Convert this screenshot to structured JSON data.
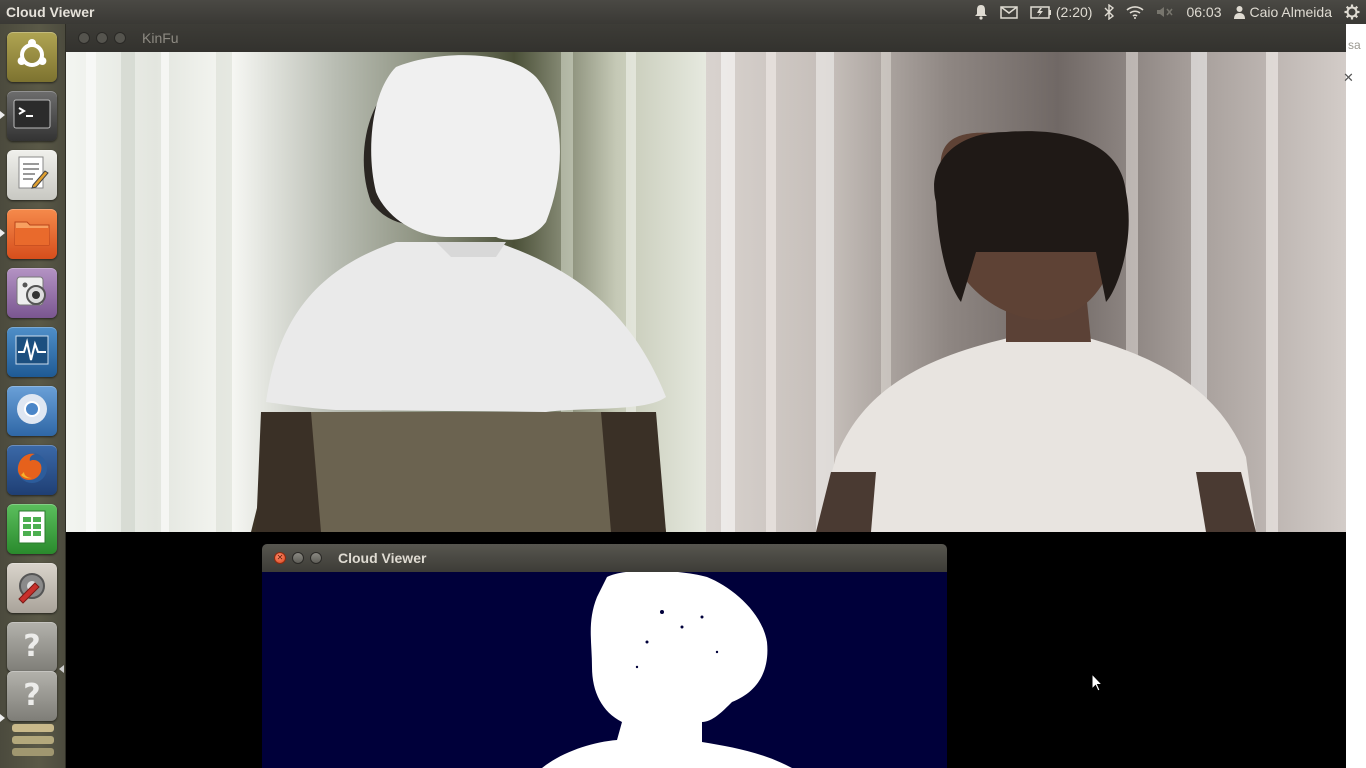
{
  "top_panel": {
    "app_title": "Cloud Viewer",
    "battery_time": "(2:20)",
    "clock": "06:03",
    "user_name": "Caio Almeida",
    "icons": [
      "bell-icon",
      "mail-icon",
      "battery-icon",
      "bluetooth-icon",
      "wifi-icon",
      "volume-muted-icon",
      "user-icon",
      "gear-icon"
    ]
  },
  "launcher": {
    "items": [
      {
        "name": "ubuntu-dash",
        "icon": "ubuntu-logo-icon",
        "color": "#9a8f3c"
      },
      {
        "name": "terminal",
        "icon": "terminal-icon",
        "color": "#3a3a3a"
      },
      {
        "name": "text-editor",
        "icon": "text-editor-icon",
        "color": "#d8d8d2"
      },
      {
        "name": "files",
        "icon": "folder-icon",
        "color": "#e8652c"
      },
      {
        "name": "cheese",
        "icon": "webcam-icon",
        "color": "#8f6aa0"
      },
      {
        "name": "system-monitor",
        "icon": "system-monitor-icon",
        "color": "#2f6fa8"
      },
      {
        "name": "chromium",
        "icon": "chromium-icon",
        "color": "#3f79b5"
      },
      {
        "name": "firefox",
        "icon": "firefox-icon",
        "color": "#d9501f"
      },
      {
        "name": "spreadsheet",
        "icon": "spreadsheet-icon",
        "color": "#3a9b3d"
      },
      {
        "name": "system-settings",
        "icon": "settings-wrench-icon",
        "color": "#c8302c"
      },
      {
        "name": "unknown-app-1",
        "icon": "question-icon",
        "color": "#8c8c86"
      },
      {
        "name": "unknown-app-2",
        "icon": "question-icon",
        "color": "#8c8c86"
      }
    ]
  },
  "kinfu_window": {
    "title": "KinFu",
    "partial_title_right": "sa"
  },
  "cloud_viewer_window": {
    "title": "Cloud Viewer"
  }
}
